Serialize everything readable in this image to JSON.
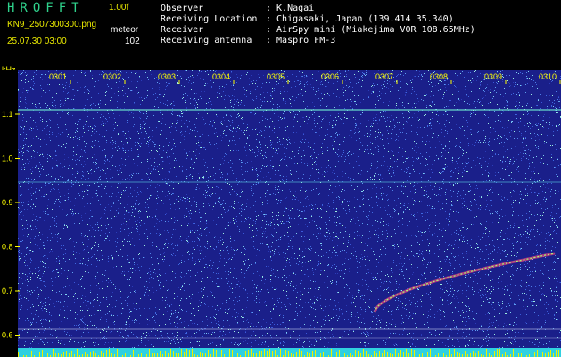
{
  "header": {
    "app_title": "HROFFT",
    "version": "1.00f",
    "filename": "KN9_2507300300.png",
    "mode": "meteor",
    "datetime": "25.07.30 03:00",
    "count": "102"
  },
  "info": [
    {
      "label": "Observer",
      "value": ": K.Nagai"
    },
    {
      "label": "Receiving Location",
      "value": ": Chigasaki, Japan (139.414 35.340)"
    },
    {
      "label": "Receiver",
      "value": ": AirSpy mini (Miakejima VOR 108.65MHz)"
    },
    {
      "label": "Receiving antenna",
      "value": ": Maspro FM-3"
    }
  ],
  "axis": {
    "unit": "kHz",
    "y_ticks": [
      "1.1",
      "1.0",
      "0.9",
      "0.8",
      "0.7",
      "0.6"
    ],
    "x_ticks": [
      "0301",
      "0302",
      "0303",
      "0304",
      "0305",
      "0306",
      "0307",
      "0308",
      "0309",
      "0310"
    ]
  },
  "colors": {
    "background": "#1a1f8a",
    "header_text": "#e8e800",
    "title": "#2fd28c",
    "baseline": "#30d0e0"
  }
}
